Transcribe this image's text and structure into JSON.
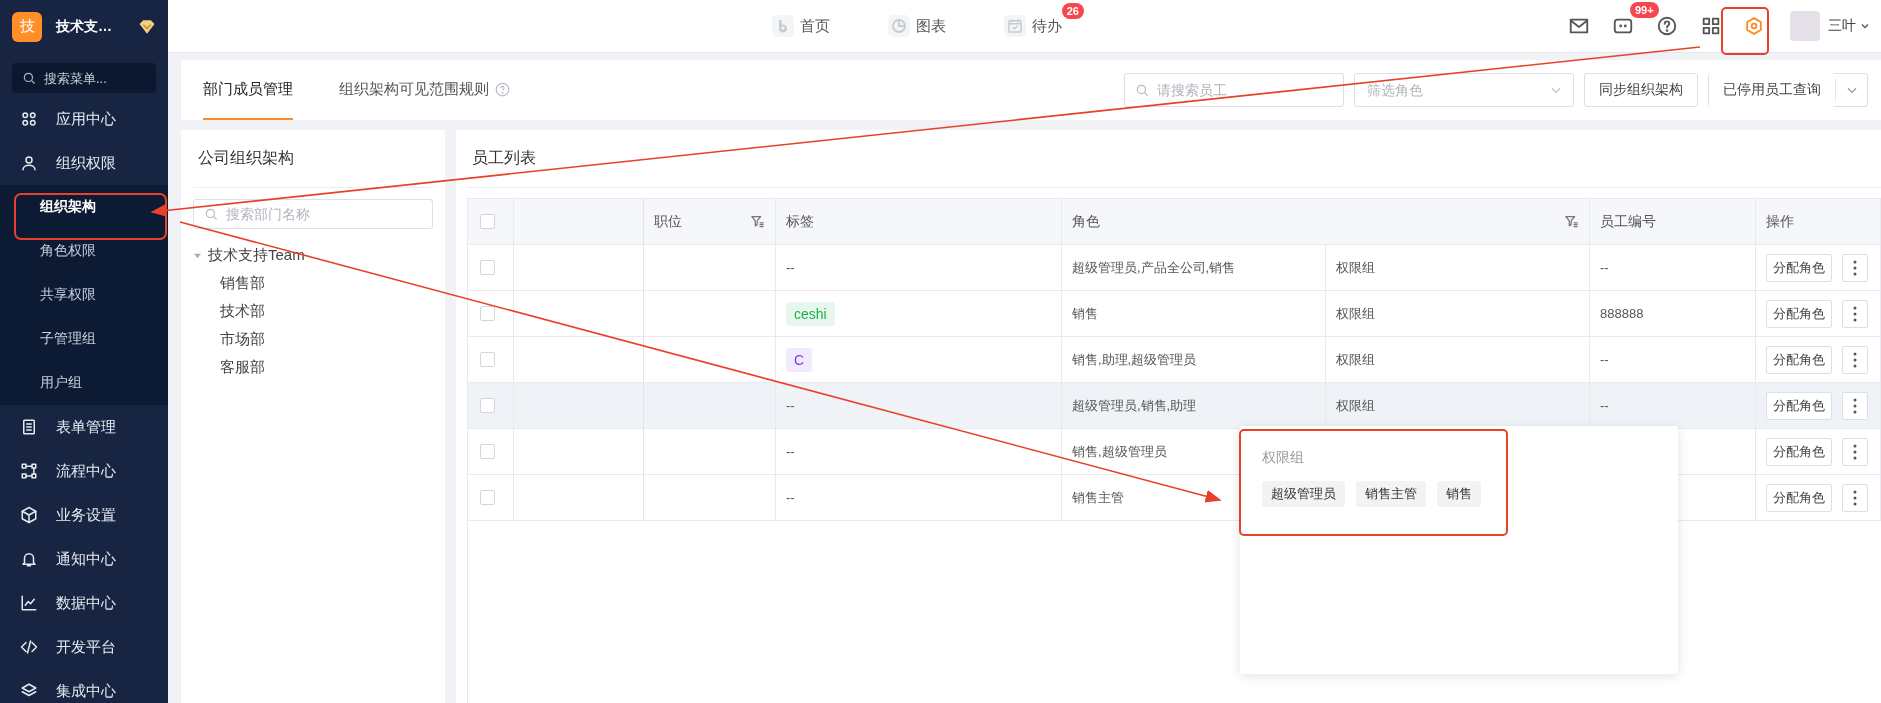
{
  "sidebar": {
    "brand": {
      "logo": "技",
      "name": "技术支…"
    },
    "search": {
      "placeholder": "搜索菜单..."
    },
    "items": [
      {
        "label": "应用中心"
      },
      {
        "label": "组织权限",
        "children": [
          {
            "label": "组织架构",
            "selected": true
          },
          {
            "label": "角色权限",
            "selected": false
          },
          {
            "label": "共享权限",
            "selected": false
          },
          {
            "label": "子管理组",
            "selected": false
          },
          {
            "label": "用户组",
            "selected": false
          }
        ]
      },
      {
        "label": "表单管理"
      },
      {
        "label": "流程中心"
      },
      {
        "label": "业务设置"
      },
      {
        "label": "通知中心"
      },
      {
        "label": "数据中心"
      },
      {
        "label": "开发平台"
      },
      {
        "label": "集成中心"
      }
    ]
  },
  "topbar": {
    "nav": [
      {
        "label": "首页",
        "kind": "home"
      },
      {
        "label": "图表",
        "kind": "chart"
      },
      {
        "label": "待办",
        "kind": "todo",
        "badge": "26"
      }
    ],
    "actions": [
      {
        "kind": "mail"
      },
      {
        "kind": "chat",
        "badge": "99+"
      },
      {
        "kind": "help"
      },
      {
        "kind": "apps"
      },
      {
        "kind": "settings"
      }
    ],
    "user": {
      "name": "三叶"
    }
  },
  "page_tabs": [
    {
      "label": "部门成员管理",
      "selected": true,
      "help": false
    },
    {
      "label": "组织架构可见范围规则",
      "selected": false,
      "help": true
    }
  ],
  "toolbar": {
    "search": {
      "placeholder": "请搜索员工"
    },
    "role_filter": {
      "placeholder": "筛选角色"
    },
    "buttons": [
      {
        "label": "同步组织架构",
        "kind": "plain"
      },
      {
        "label": "已停用员工查询",
        "kind": "split"
      }
    ]
  },
  "org_panel": {
    "title": "公司组织架构",
    "search": {
      "placeholder": "搜索部门名称"
    },
    "tree": [
      {
        "label": "技术支持Team",
        "expanded": true,
        "children": [
          {
            "label": "销售部"
          },
          {
            "label": "技术部"
          },
          {
            "label": "市场部"
          },
          {
            "label": "客服部"
          }
        ]
      }
    ]
  },
  "employee_panel": {
    "title": "员工列表",
    "table": {
      "header_checked": false,
      "columns": [
        {
          "label": "职位",
          "filter": true
        },
        {
          "label": "标签",
          "filter": false
        },
        {
          "label": "角色",
          "filter": true
        },
        {
          "label": "员工编号",
          "filter": false
        },
        {
          "label": "操作",
          "filter": false
        }
      ],
      "rows": [
        {
          "checked": false,
          "hovered": false,
          "tag": {
            "label": "--"
          },
          "role": "超级管理员,产品全公司,销售",
          "group": "权限组",
          "employee_no": "--",
          "action": "分配角色"
        },
        {
          "checked": false,
          "hovered": false,
          "tag": {
            "label": "ceshi",
            "color": "#20b14b"
          },
          "role": "销售",
          "group": "权限组",
          "employee_no": "888888",
          "action": "分配角色"
        },
        {
          "checked": false,
          "hovered": false,
          "tag": {
            "label": "C",
            "color": "#7b3ff2"
          },
          "role": "销售,助理,超级管理员",
          "group": "权限组",
          "employee_no": "--",
          "action": "分配角色"
        },
        {
          "checked": false,
          "hovered": true,
          "tag": {
            "label": "--"
          },
          "role": "超级管理员,销售,助理",
          "group": "权限组",
          "employee_no": "--",
          "action": "分配角色"
        },
        {
          "checked": false,
          "hovered": false,
          "tag": {
            "label": "--"
          },
          "role": "销售,超级管理员",
          "action": "分配角色"
        },
        {
          "checked": false,
          "hovered": false,
          "tag": {
            "label": "--"
          },
          "role": "销售主管",
          "action": "分配角色"
        }
      ]
    }
  },
  "popover": {
    "title": "权限组",
    "chips": [
      "超级管理员",
      "销售主管",
      "销售"
    ]
  }
}
